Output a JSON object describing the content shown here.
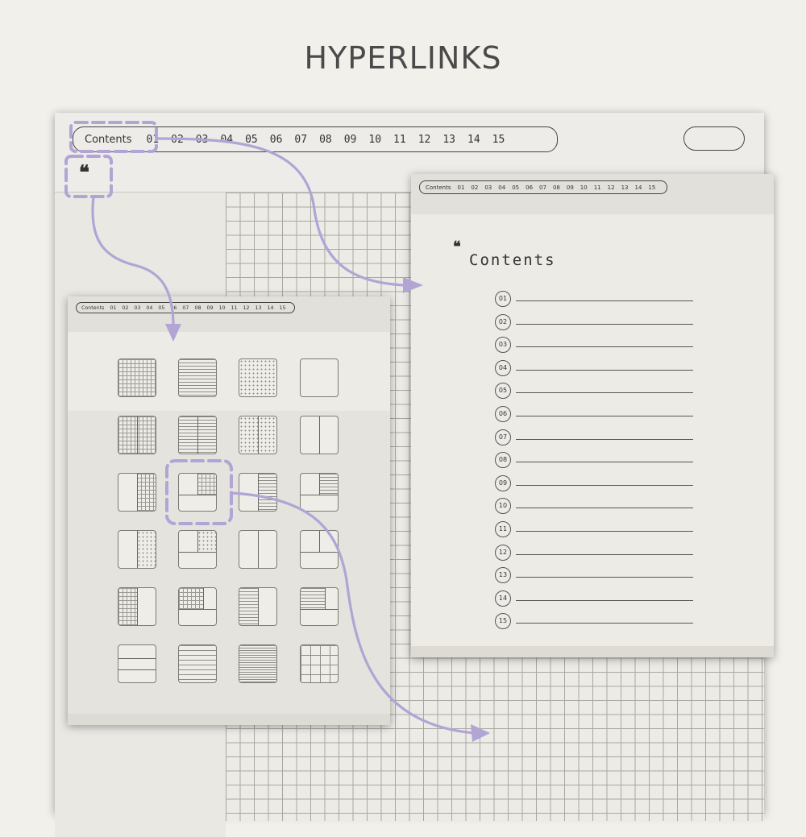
{
  "heading": "HYPERLINKS",
  "main_tabs": [
    "Contents",
    "01",
    "02",
    "03",
    "04",
    "05",
    "06",
    "07",
    "08",
    "09",
    "10",
    "11",
    "12",
    "13",
    "14",
    "15"
  ],
  "main_quote": "❝",
  "right_page": {
    "tabs": [
      "Contents",
      "01",
      "02",
      "03",
      "04",
      "05",
      "06",
      "07",
      "08",
      "09",
      "10",
      "11",
      "12",
      "13",
      "14",
      "15"
    ],
    "quote": "❝",
    "title": "Contents",
    "entries": [
      "01",
      "02",
      "03",
      "04",
      "05",
      "06",
      "07",
      "08",
      "09",
      "10",
      "11",
      "12",
      "13",
      "14",
      "15"
    ]
  },
  "left_page": {
    "tabs": [
      "Contents",
      "01",
      "02",
      "03",
      "04",
      "05",
      "06",
      "07",
      "08",
      "09",
      "10",
      "11",
      "12",
      "13",
      "14",
      "15"
    ]
  },
  "colors": {
    "accent": "#b2a4d4",
    "background": "#f2f0eb",
    "ink": "#3a3a3a"
  },
  "icons": {
    "quote": "quote-icon",
    "arrow": "arrow-icon"
  }
}
